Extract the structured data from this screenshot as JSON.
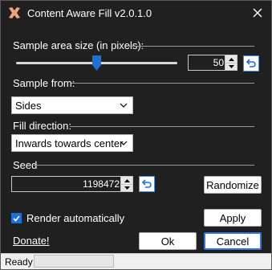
{
  "window": {
    "title": "Content Aware Fill v2.0.1.0",
    "icon": "content-aware-fill-x-icon",
    "close_icon": "close-icon"
  },
  "sample_area": {
    "label": "Sample area size (in pixels):",
    "value": "50",
    "slider_fraction": 0.48
  },
  "sample_from": {
    "label": "Sample from:",
    "selected": "Sides"
  },
  "fill_direction": {
    "label": "Fill direction:",
    "selected": "Inwards towards center"
  },
  "seed": {
    "label": "Seed",
    "value": "1198472",
    "randomize_label": "Randomize"
  },
  "render": {
    "label": "Render automatically",
    "checked": true,
    "apply_label": "Apply"
  },
  "footer": {
    "donate_label": "Donate!",
    "ok_label": "Ok",
    "cancel_label": "Cancel"
  },
  "status": {
    "text": "Ready",
    "progress": 0
  },
  "colors": {
    "accent": "#1e6fd8",
    "background": "#202020",
    "text": "#ffffff"
  }
}
